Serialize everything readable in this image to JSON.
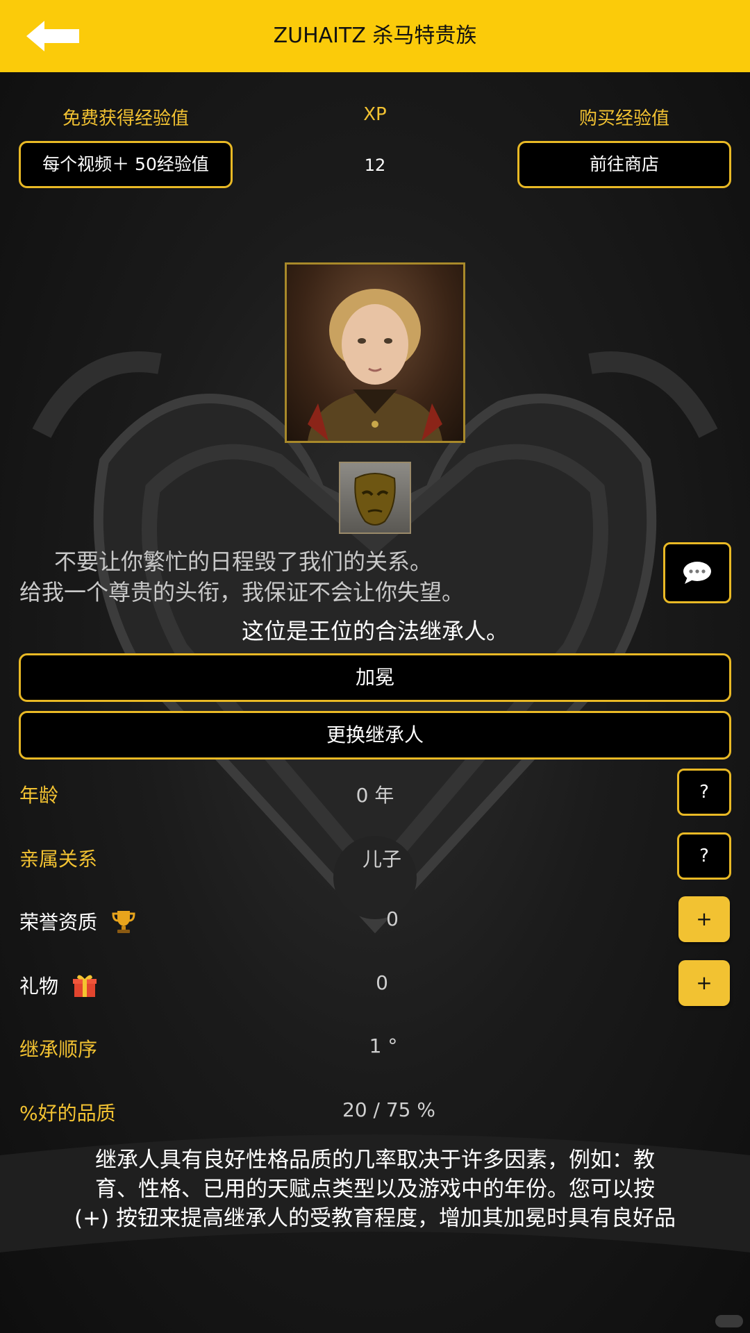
{
  "header": {
    "title": "ZUHAITZ 杀马特贵族"
  },
  "xp_bar": {
    "free_label": "免费获得经验值",
    "free_button": "每个视频＋ 50经验值",
    "xp_label": "XP",
    "xp_value": "12",
    "buy_label": "购买经验值",
    "shop_button": "前往商店"
  },
  "heir": {
    "quote_line1": "不要让你繁忙的日程毁了我们的关系。",
    "quote_line2": "给我一个尊贵的头衔，我保证不会让你失望。",
    "legitimacy": "这位是王位的合法继承人。",
    "crown_button": "加冕",
    "change_button": "更换继承人"
  },
  "stats": {
    "age_label": "年龄",
    "age_value": "0 年",
    "age_help": "?",
    "relation_label": "亲属关系",
    "relation_value": "儿子",
    "relation_help": "?",
    "honor_label": "荣誉资质",
    "honor_value": "0",
    "honor_plus": "+",
    "gift_label": "礼物",
    "gift_value": "0",
    "gift_plus": "+",
    "order_label": "继承顺序",
    "order_value": "1 °",
    "quality_label": "%好的品质",
    "quality_value": "20 / 75 %"
  },
  "description": {
    "line1": "继承人具有良好性格品质的几率取决于许多因素，例如：教",
    "line2": "育、性格、已用的天赋点类型以及游戏中的年份。您可以按",
    "line3": "(+) 按钮来提高继承人的受教育程度，增加其加冕时具有良好品"
  },
  "colors": {
    "header": "#fbcb0a",
    "accent": "#f2c232",
    "border": "#e9b925",
    "background": "#141414"
  },
  "icons": {
    "back": "arrow-left-icon",
    "chat": "speech-bubble-icon",
    "honor": "trophy-icon",
    "gift": "gift-icon"
  }
}
